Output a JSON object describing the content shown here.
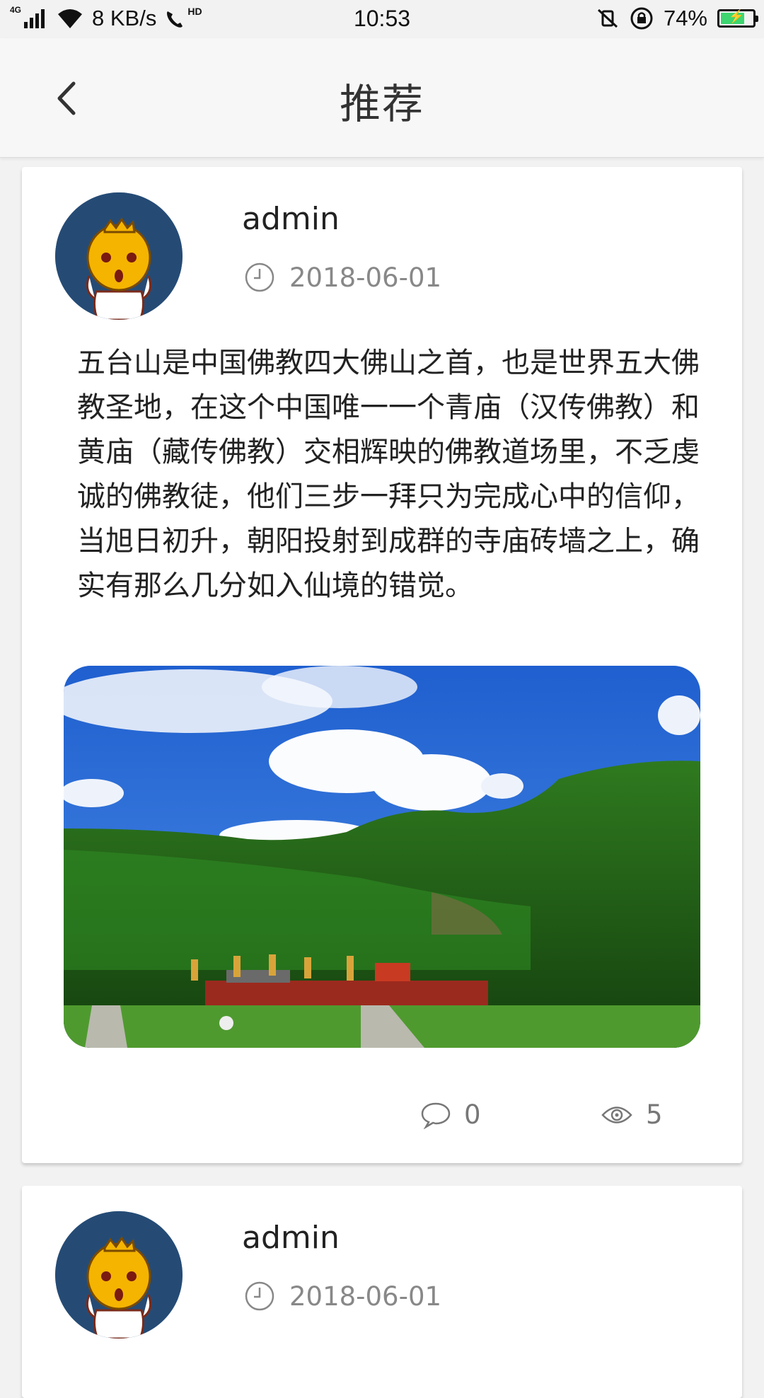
{
  "status_bar": {
    "network": "4G",
    "speed": "8 KB/s",
    "hd": "HD",
    "time": "10:53",
    "battery": "74%",
    "battery_level": 0.74,
    "battery_color": "#3dd670"
  },
  "nav": {
    "title": "推荐",
    "back_icon": "chevron-left-icon"
  },
  "posts": [
    {
      "author": "admin",
      "date": "2018-06-01",
      "content": "五台山是中国佛教四大佛山之首，也是世界五大佛教圣地，在这个中国唯一一个青庙（汉传佛教）和黄庙（藏传佛教）交相辉映的佛教道场里，不乏虔诚的佛教徒，他们三步一拜只为完成心中的信仰，当旭日初升，朝阳投射到成群的寺庙砖墙之上，确实有那么几分如入仙境的错觉。",
      "comments": "0",
      "views": "5"
    },
    {
      "author": "admin",
      "date": "2018-06-01"
    }
  ],
  "colors": {
    "avatar_bg": "#254b75",
    "meta_text": "#888888"
  }
}
